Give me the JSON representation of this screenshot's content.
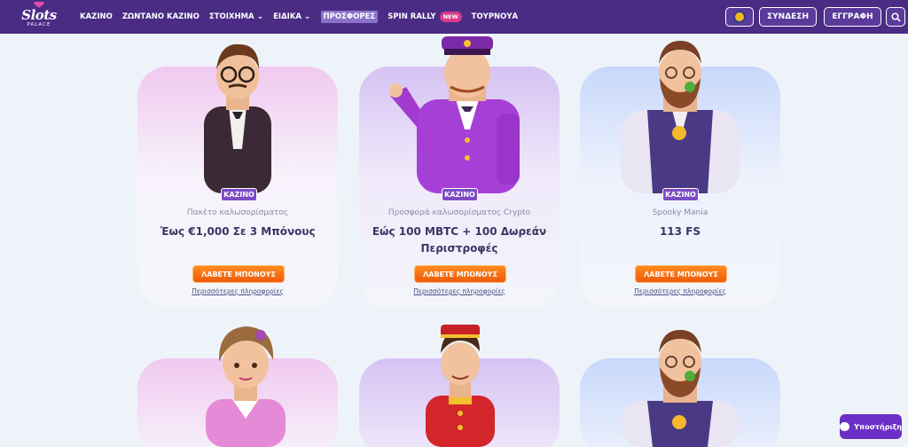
{
  "logo": {
    "text": "Slots",
    "subtext": "PALACE"
  },
  "nav": [
    {
      "label": "ΚΑΖΙΝΟ",
      "dropdown": false
    },
    {
      "label": "ΖΩΝΤΑΝΟ ΚΑΖΙΝΟ",
      "dropdown": false
    },
    {
      "label": "ΣΤΟΙΧΗΜΑ",
      "dropdown": true
    },
    {
      "label": "ΕΙΔΙΚΑ",
      "dropdown": true
    },
    {
      "label": "ΠΡΟΣΦΟΡΕΣ",
      "active": true
    },
    {
      "label": "SPIN RALLY",
      "badge": "NEW"
    },
    {
      "label": "ΤΟΥΡΝΟΥΑ"
    }
  ],
  "header_buttons": {
    "login": "ΣΥΝΔΕΣΗ",
    "register": "ΕΓΓΡΑΦΗ"
  },
  "cards": [
    {
      "tag": "ΚΑΖΙΝΟ",
      "subtitle": "Πακέτο καλωσορίσματος",
      "title": "Έως €1,000 Σε 3 Μπόνους",
      "button": "ΛΑΒΕΤΕ ΜΠΟΝΟΥΣ",
      "link": "Περισσότερες πληροφορίες"
    },
    {
      "tag": "ΚΑΖΙΝΟ",
      "subtitle": "Προσφορά καλωσορίσματος Crypto",
      "title": "Εώς 100 MBTC + 100 Δωρεάν Περιστροφές",
      "button": "ΛΑΒΕΤΕ ΜΠΟΝΟΥΣ",
      "link": "Περισσότερες πληροφορίες"
    },
    {
      "tag": "ΚΑΖΙΝΟ",
      "subtitle": "Spooky Mania",
      "title": "113 FS",
      "button": "ΛΑΒΕΤΕ ΜΠΟΝΟΥΣ",
      "link": "Περισσότερες πληροφορίες"
    }
  ],
  "support": {
    "label": "Υποστήριξη"
  },
  "colors": {
    "header": "#4a2c85",
    "accent_orange": "#f05a0a",
    "tag_purple": "#7b4cc4"
  }
}
